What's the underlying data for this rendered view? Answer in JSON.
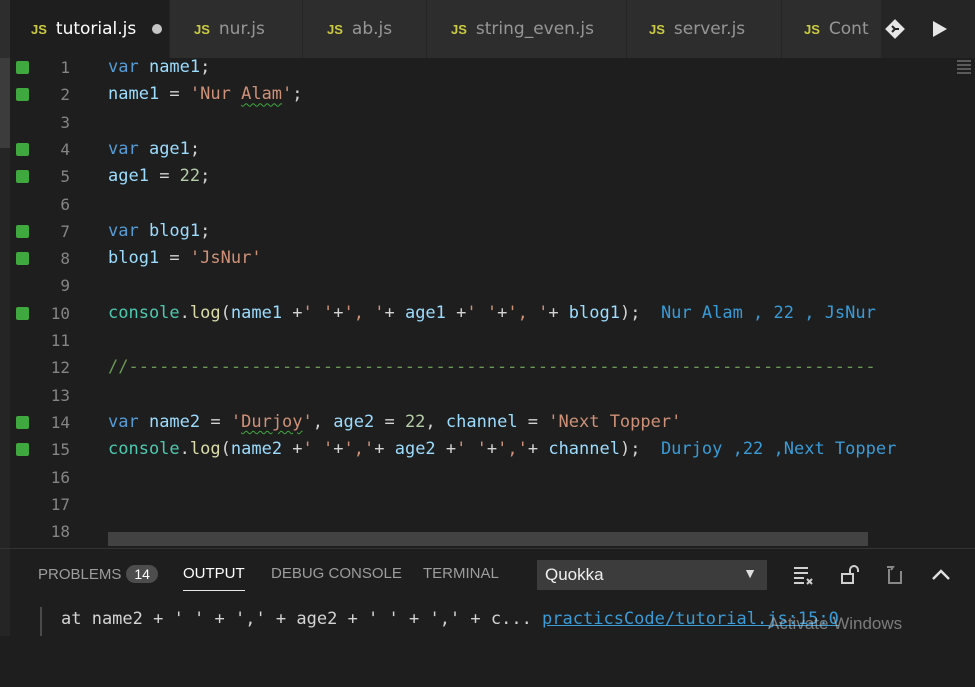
{
  "tabs": [
    {
      "icon": "JS",
      "label": "tutorial.js",
      "active": true,
      "dirty": true
    },
    {
      "icon": "JS",
      "label": "nur.js"
    },
    {
      "icon": "JS",
      "label": "ab.js"
    },
    {
      "icon": "JS",
      "label": "string_even.js"
    },
    {
      "icon": "JS",
      "label": "server.js"
    },
    {
      "icon": "JS",
      "label": "Cont"
    }
  ],
  "tab_actions": [
    "git-compare-icon",
    "run-icon"
  ],
  "editor": {
    "lines": [
      {
        "n": "1",
        "marked": true,
        "tokens": [
          [
            "kw",
            "var "
          ],
          [
            "var",
            "name1"
          ],
          [
            "plain",
            ";"
          ]
        ]
      },
      {
        "n": "2",
        "marked": true,
        "tokens": [
          [
            "var",
            "name1"
          ],
          [
            "plain",
            " = "
          ],
          [
            "str",
            "'Nur "
          ],
          [
            "str squig",
            "Alam"
          ],
          [
            "str",
            "'"
          ],
          [
            "plain",
            ";"
          ]
        ]
      },
      {
        "n": "3",
        "marked": false,
        "tokens": []
      },
      {
        "n": "4",
        "marked": true,
        "tokens": [
          [
            "kw",
            "var "
          ],
          [
            "var",
            "age1"
          ],
          [
            "plain",
            ";"
          ]
        ]
      },
      {
        "n": "5",
        "marked": true,
        "tokens": [
          [
            "var",
            "age1"
          ],
          [
            "plain",
            " = "
          ],
          [
            "num",
            "22"
          ],
          [
            "plain",
            ";"
          ]
        ]
      },
      {
        "n": "6",
        "marked": false,
        "tokens": []
      },
      {
        "n": "7",
        "marked": true,
        "tokens": [
          [
            "kw",
            "var "
          ],
          [
            "var",
            "blog1"
          ],
          [
            "plain",
            ";"
          ]
        ]
      },
      {
        "n": "8",
        "marked": true,
        "tokens": [
          [
            "var",
            "blog1"
          ],
          [
            "plain",
            " = "
          ],
          [
            "str",
            "'JsNur'"
          ]
        ]
      },
      {
        "n": "9",
        "marked": false,
        "tokens": []
      },
      {
        "n": "10",
        "marked": true,
        "tokens": [
          [
            "obj",
            "console"
          ],
          [
            "plain",
            "."
          ],
          [
            "fn",
            "log"
          ],
          [
            "plain",
            "("
          ],
          [
            "var",
            "name1"
          ],
          [
            "plain",
            " +"
          ],
          [
            "str",
            "' '"
          ],
          [
            "plain",
            "+"
          ],
          [
            "str",
            "', '"
          ],
          [
            "plain",
            "+ "
          ],
          [
            "var",
            "age1"
          ],
          [
            "plain",
            " +"
          ],
          [
            "str",
            "' '"
          ],
          [
            "plain",
            "+"
          ],
          [
            "str",
            "', '"
          ],
          [
            "plain",
            "+ "
          ],
          [
            "var",
            "blog1"
          ],
          [
            "plain",
            ");"
          ]
        ],
        "result": "Nur Alam , 22 , JsNur"
      },
      {
        "n": "11",
        "marked": false,
        "tokens": []
      },
      {
        "n": "12",
        "marked": false,
        "tokens": [
          [
            "cmt",
            "//-------------------------------------------------------------------------"
          ]
        ]
      },
      {
        "n": "13",
        "marked": false,
        "tokens": []
      },
      {
        "n": "14",
        "marked": true,
        "tokens": [
          [
            "kw",
            "var "
          ],
          [
            "var",
            "name2"
          ],
          [
            "plain",
            " = "
          ],
          [
            "str",
            "'"
          ],
          [
            "str squig",
            "Durjoy"
          ],
          [
            "str",
            "'"
          ],
          [
            "plain",
            ", "
          ],
          [
            "var",
            "age2"
          ],
          [
            "plain",
            " = "
          ],
          [
            "num",
            "22"
          ],
          [
            "plain",
            ", "
          ],
          [
            "var",
            "channel"
          ],
          [
            "plain",
            " = "
          ],
          [
            "str",
            "'Next Topper'"
          ]
        ]
      },
      {
        "n": "15",
        "marked": true,
        "tokens": [
          [
            "obj",
            "console"
          ],
          [
            "plain",
            "."
          ],
          [
            "fn",
            "log"
          ],
          [
            "plain",
            "("
          ],
          [
            "var",
            "name2"
          ],
          [
            "plain",
            " +"
          ],
          [
            "str",
            "' '"
          ],
          [
            "plain",
            "+"
          ],
          [
            "str",
            "','"
          ],
          [
            "plain",
            "+ "
          ],
          [
            "var",
            "age2"
          ],
          [
            "plain",
            " +"
          ],
          [
            "str",
            "' '"
          ],
          [
            "plain",
            "+"
          ],
          [
            "str",
            "','"
          ],
          [
            "plain",
            "+ "
          ],
          [
            "var",
            "channel"
          ],
          [
            "plain",
            ");"
          ]
        ],
        "result": "Durjoy ,22 ,Next Topper"
      },
      {
        "n": "16",
        "marked": false,
        "tokens": []
      },
      {
        "n": "17",
        "marked": false,
        "tokens": []
      },
      {
        "n": "18",
        "marked": false,
        "tokens": []
      }
    ]
  },
  "panel": {
    "tabs": {
      "problems": "PROBLEMS",
      "problems_count": "14",
      "output": "OUTPUT",
      "debug": "DEBUG CONSOLE",
      "terminal": "TERMINAL"
    },
    "active_tab": "OUTPUT",
    "output_channel": "Quokka",
    "output_line_text": "at name2 + ' ' + ',' + age2 + ' ' + ',' + c... ",
    "output_line_link": "practicsCode/tutorial.js:15:0"
  },
  "watermark": "Activate Windows",
  "colors": {
    "accent": "#3a9bd6",
    "git_marker": "#3fa83f",
    "js_icon": "#cbcb41"
  }
}
